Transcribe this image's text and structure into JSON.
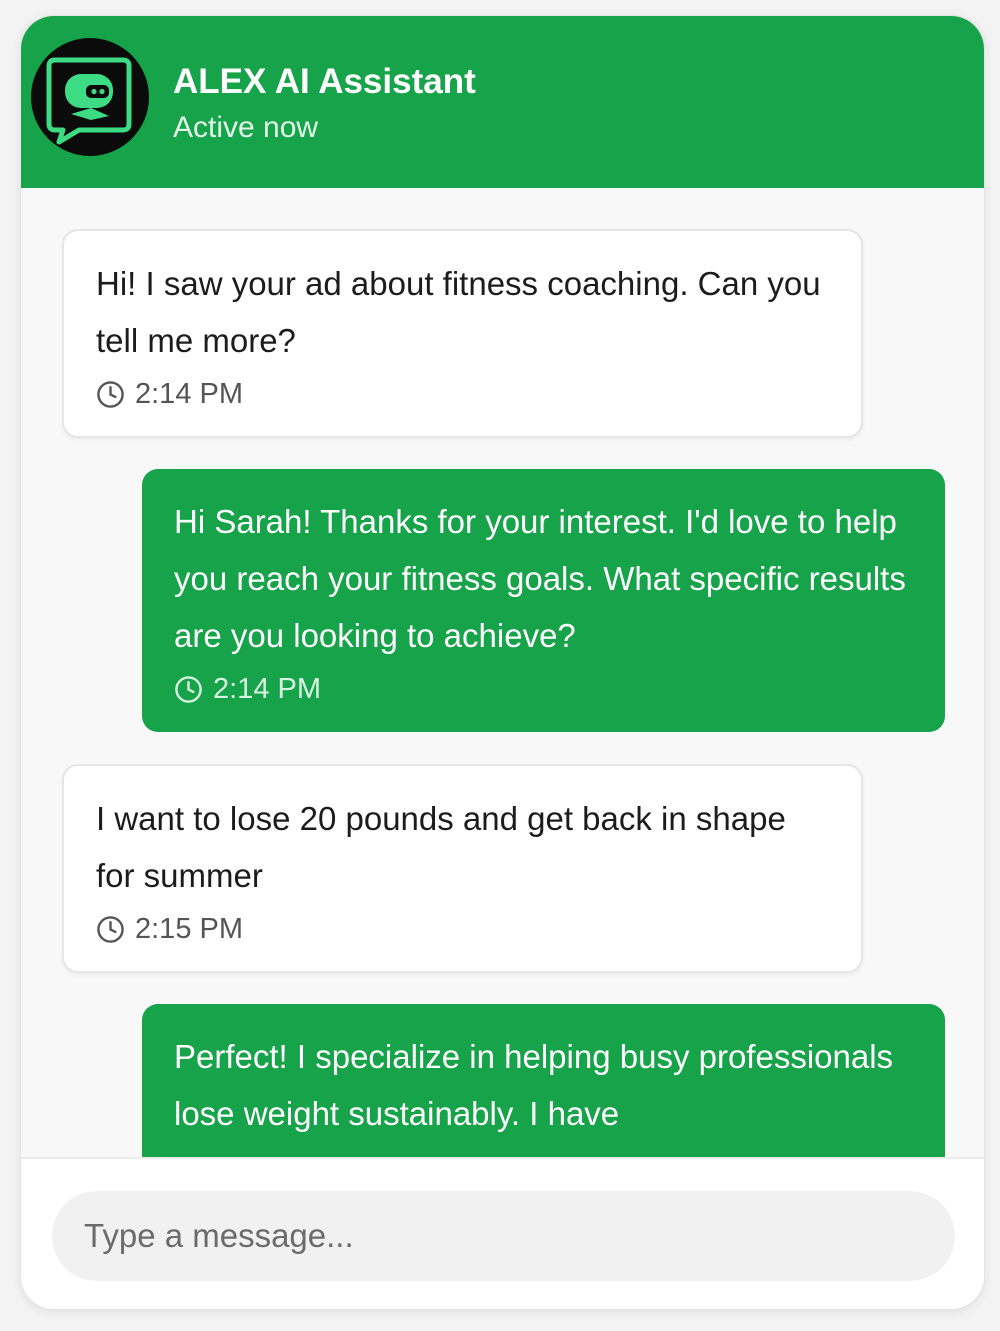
{
  "header": {
    "title": "ALEX AI Assistant",
    "status": "Active now",
    "avatar_icon": "robot-chat-icon",
    "bg_color": "#16a34a"
  },
  "messages": [
    {
      "sender": "user",
      "text": "Hi! I saw your ad about fitness coaching. Can you tell me more?",
      "time": "2:14 PM"
    },
    {
      "sender": "assistant",
      "text": "Hi Sarah! Thanks for your interest. I'd love to help you reach your fitness goals. What specific results are you looking to achieve?",
      "time": "2:14 PM"
    },
    {
      "sender": "user",
      "text": "I want to lose 20 pounds and get back in shape for summer",
      "time": "2:15 PM"
    },
    {
      "sender": "assistant",
      "text": "Perfect! I specialize in helping busy professionals lose weight sustainably. I have"
    }
  ],
  "composer": {
    "placeholder": "Type a message..."
  },
  "colors": {
    "accent": "#16a34a",
    "avatar_bg": "#0b0b0b",
    "avatar_glyph": "#3ddc84"
  }
}
